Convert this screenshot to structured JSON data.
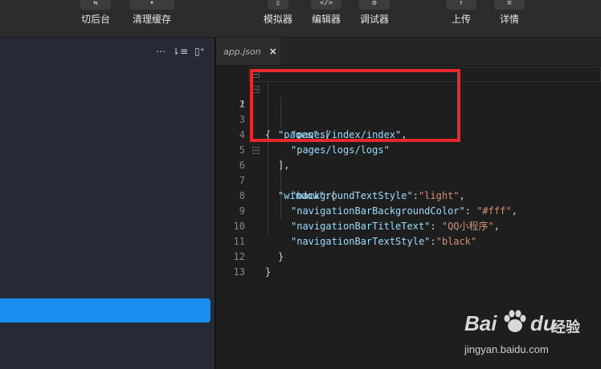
{
  "toolbar": {
    "buttons": [
      {
        "label": "切后台",
        "icon": "switch-background-icon"
      },
      {
        "label": "清理缓存",
        "icon": "clear-cache-icon"
      },
      {
        "label": "模拟器",
        "icon": "simulator-icon"
      },
      {
        "label": "编辑器",
        "icon": "editor-icon"
      },
      {
        "label": "调试器",
        "icon": "debugger-icon"
      },
      {
        "label": "上传",
        "icon": "upload-icon"
      },
      {
        "label": "详情",
        "icon": "details-icon"
      }
    ]
  },
  "left_panel": {
    "header_icons": [
      "more-icon",
      "sort-icon",
      "split-icon"
    ]
  },
  "editor": {
    "tab": {
      "name": "app.json",
      "close": "×"
    },
    "active_line": 1,
    "lines": [
      {
        "n": "1",
        "text": "{"
      },
      {
        "n": "2",
        "text": "\"pages\":["
      },
      {
        "n": "3",
        "text": "\"pages/index/index\","
      },
      {
        "n": "4",
        "text": "\"pages/logs/logs\""
      },
      {
        "n": "5",
        "text": "],"
      },
      {
        "n": "6",
        "text": "\"window\":{"
      },
      {
        "n": "7",
        "text": "\"backgroundTextStyle\":\"light\","
      },
      {
        "n": "8",
        "text": "\"navigationBarBackgroundColor\": \"#fff\","
      },
      {
        "n": "9",
        "text": "\"navigationBarTitleText\": \"QQ小程序\","
      },
      {
        "n": "10",
        "text": "\"navigationBarTextStyle\":\"black\""
      },
      {
        "n": "11",
        "text": "}"
      },
      {
        "n": "12",
        "text": "}"
      },
      {
        "n": "13",
        "text": ""
      }
    ]
  },
  "annotation": {
    "color": "#e8282e"
  },
  "colors": {
    "accent": "#1a8ef0",
    "key": "#9cdcfe",
    "string": "#ce9178",
    "punct": "#d4d4d4"
  },
  "watermark": {
    "brand_a": "Bai",
    "brand_b": "du",
    "brand_cn": "经验",
    "url": "jingyan.baidu.com"
  }
}
